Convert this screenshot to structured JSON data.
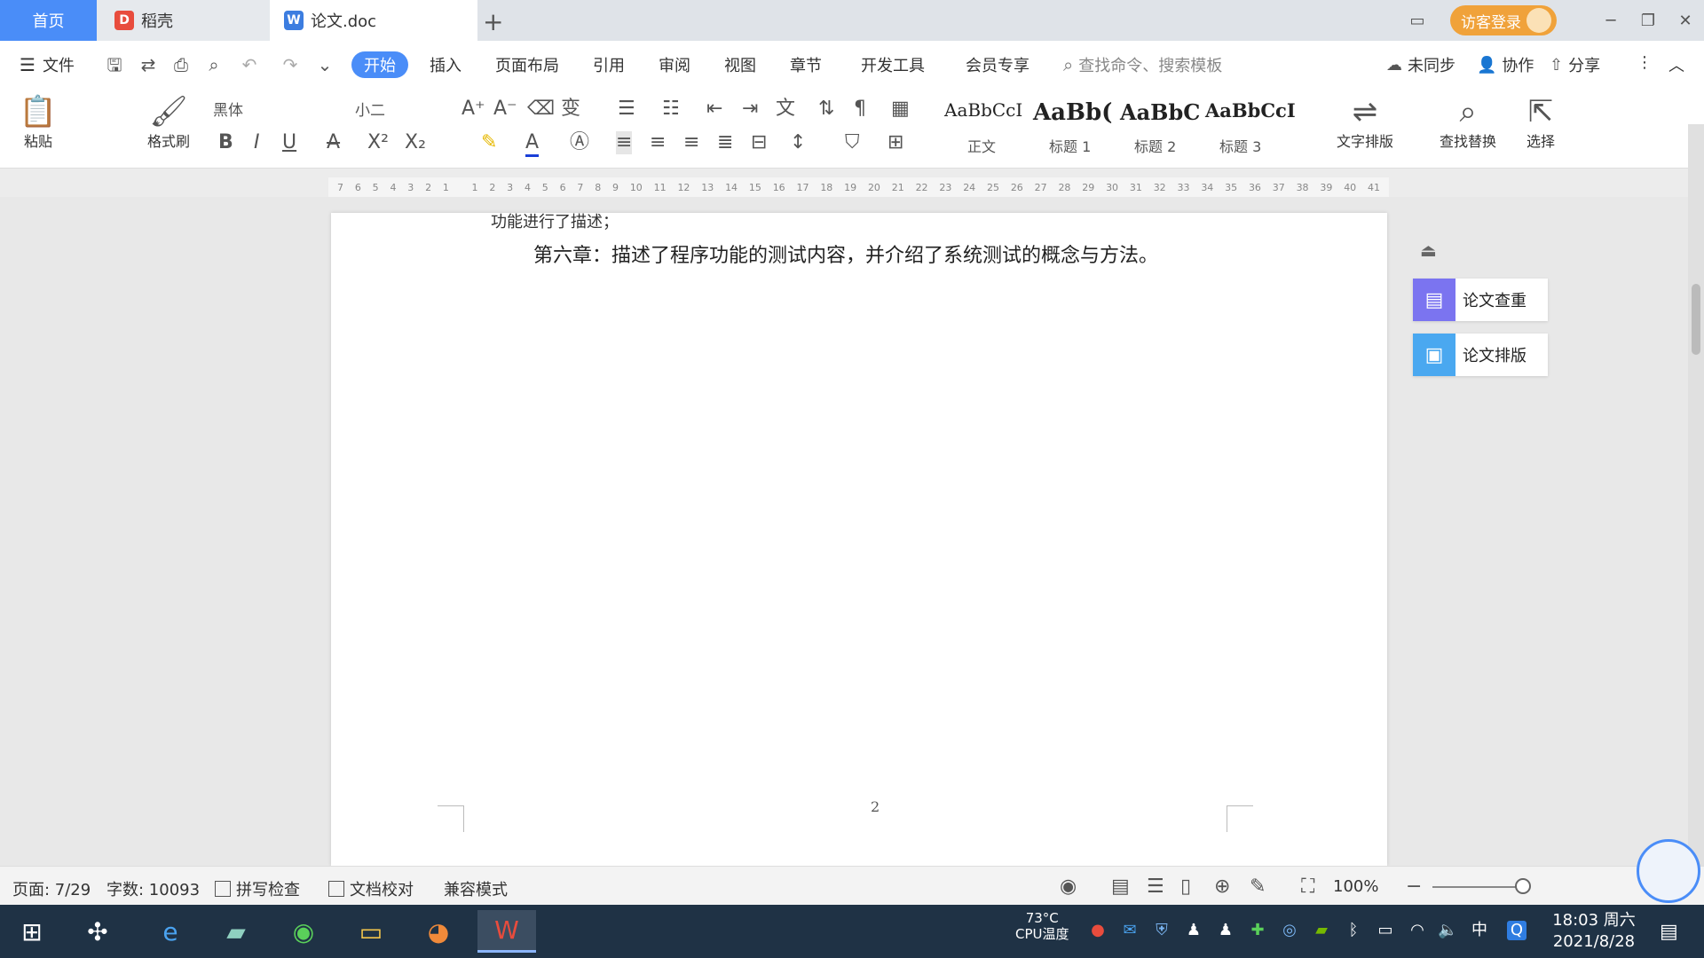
{
  "tabs": {
    "home": "首页",
    "daoke": "稻壳",
    "doc": "论文.doc",
    "add": "+"
  },
  "titlebar": {
    "login": "访客登录",
    "layout_icon": "layout-icon",
    "minimize": "─",
    "restore": "❐",
    "close": "✕"
  },
  "menu": {
    "file": "文件",
    "start": "开始",
    "insert": "插入",
    "page_layout": "页面布局",
    "references": "引用",
    "review": "审阅",
    "view": "视图",
    "chapter": "章节",
    "dev_tools": "开发工具",
    "member": "会员专享",
    "search_placeholder": "查找命令、搜索模板",
    "unsynced": "未同步",
    "collab": "协作",
    "share": "分享"
  },
  "ribbon": {
    "paste": "粘贴",
    "format_painter": "格式刷",
    "font_name": "黑体",
    "font_size": "小二",
    "styles": [
      {
        "sample": "AaBbCcI",
        "label": "正文"
      },
      {
        "sample": "AaBb(",
        "label": "标题 1"
      },
      {
        "sample": "AaBbC",
        "label": "标题 2"
      },
      {
        "sample": "AaBbCcI",
        "label": "标题 3"
      }
    ],
    "text_layout": "文字排版",
    "find_replace": "查找替换",
    "select": "选择"
  },
  "ruler": [
    "7",
    "6",
    "5",
    "4",
    "3",
    "2",
    "1",
    "",
    "1",
    "2",
    "3",
    "4",
    "5",
    "6",
    "7",
    "8",
    "9",
    "10",
    "11",
    "12",
    "13",
    "14",
    "15",
    "16",
    "17",
    "18",
    "19",
    "20",
    "21",
    "22",
    "23",
    "24",
    "25",
    "26",
    "27",
    "28",
    "29",
    "30",
    "31",
    "32",
    "33",
    "34",
    "35",
    "36",
    "37",
    "38",
    "39",
    "40",
    "41"
  ],
  "document": {
    "cut_line": "功能进行了描述；",
    "chapter6": "第六章：描述了程序功能的测试内容，并介绍了系统测试的概念与方法。",
    "page_number": "2"
  },
  "sidepanel": {
    "check": "论文查重",
    "format": "论文排版"
  },
  "statusbar": {
    "page": "页面: 7/29",
    "words": "字数: 10093",
    "spell": "拼写检查",
    "proof": "文档校对",
    "compat": "兼容模式",
    "zoom": "100%"
  },
  "taskbar": {
    "cpu_temp": "73°C",
    "cpu_label": "CPU温度",
    "ime": "中",
    "time": "18:03 周六",
    "date": "2021/8/28"
  },
  "colors": {
    "accent": "#4a8df8",
    "login": "#f0a23a",
    "taskbar": "#1f3245",
    "check_icon": "#7b74f0",
    "format_icon": "#4aa8f0"
  }
}
